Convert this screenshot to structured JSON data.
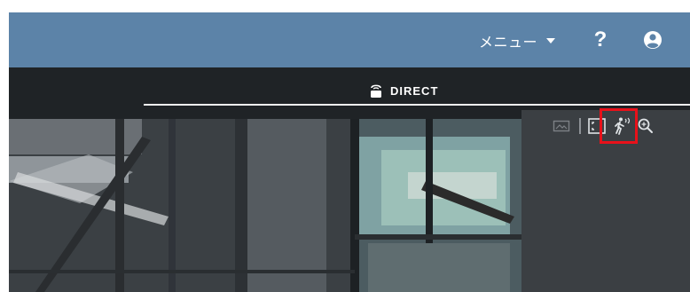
{
  "header": {
    "menu_label": "メニュー",
    "menu_caret_icon": "caret-down-icon",
    "help_label": "?",
    "user_icon": "user-circle-icon",
    "background_color": "#5c83a8"
  },
  "tabs": [
    {
      "label": "DIRECT",
      "icon": "camera-icon",
      "active": true
    }
  ],
  "toolbar": {
    "items": [
      {
        "icon": "image-icon",
        "enabled": false
      },
      {
        "icon": "fullscreen-frame-icon",
        "highlighted": true
      },
      {
        "icon": "motion-detect-icon"
      },
      {
        "icon": "zoom-icon"
      }
    ],
    "highlight_color": "#e8111a"
  }
}
